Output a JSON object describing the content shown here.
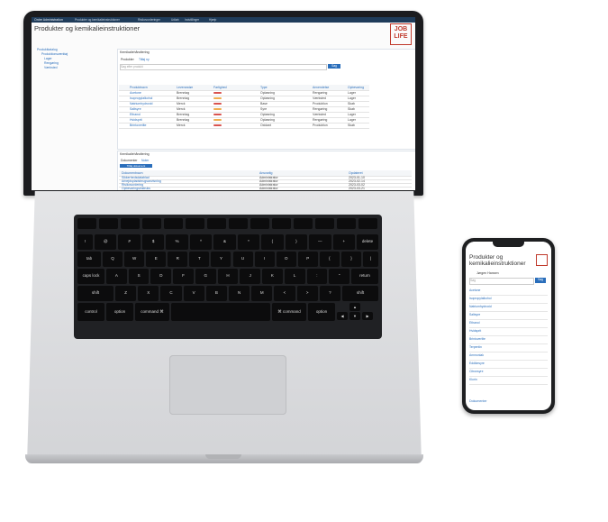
{
  "laptop": {
    "screen": {
      "topbar_title": "Ordre Administration",
      "topbar_nav": [
        "Produkter og kemikalieinstruktioner",
        "Risikovurderinger",
        "Udløb",
        "Indstillinger",
        "Hjælp"
      ],
      "page_title": "Produkter og kemikalieinstruktioner",
      "logo": {
        "line1": "JOB",
        "line2": "LIFE"
      },
      "tree": [
        "Produktkatalog",
        "Produktionsværktøj",
        "Lager",
        "Rengøring",
        "Værksted"
      ],
      "section_title": "Kemikaliehåndtering",
      "tabs": [
        "Produkter",
        "Tilføj ny"
      ],
      "search_placeholder": "Søg efter produkt",
      "search_button": "Søg",
      "table_headers": [
        "Produktnavn",
        "Leverandør",
        "Farlighed",
        "",
        "Type",
        "Anvendelse",
        "Opbevaring"
      ],
      "table_rows": [
        {
          "name": "Acetone",
          "supplier": "Brenntag",
          "type": "Opløsning",
          "use": "Rengøring",
          "storage": "Lager"
        },
        {
          "name": "Isopropylalkohol",
          "supplier": "Brenntag",
          "type": "Opløsning",
          "use": "Værksted",
          "storage": "Lager"
        },
        {
          "name": "Natriumhydroxid",
          "supplier": "Merck",
          "type": "Base",
          "use": "Produktion",
          "storage": "Skab"
        },
        {
          "name": "Saltsyre",
          "supplier": "Merck",
          "type": "Syre",
          "use": "Rengøring",
          "storage": "Skab"
        },
        {
          "name": "Ethanol",
          "supplier": "Brenntag",
          "type": "Opløsning",
          "use": "Værksted",
          "storage": "Lager"
        },
        {
          "name": "Hvidsprit",
          "supplier": "Brenntag",
          "type": "Opløsning",
          "use": "Rengøring",
          "storage": "Lager"
        },
        {
          "name": "Brintoverilte",
          "supplier": "Merck",
          "type": "Oxidant",
          "use": "Produktion",
          "storage": "Skab"
        }
      ],
      "lower_section_title": "Kemikaliehåndtering",
      "lower_tabs": [
        "Dokumenter",
        "Noter"
      ],
      "lower_button": "Tilføj dokument",
      "lower_headers": [
        "Dokumentnavn",
        "Ansvarlig",
        "Opdateret"
      ],
      "lower_rows": [
        {
          "doc": "Sikkerhedsdatablad",
          "who": "Administrator",
          "date": "2023-01-10"
        },
        {
          "doc": "Arbejdspladsbrugsanvisning",
          "who": "Administrator",
          "date": "2023-02-14"
        },
        {
          "doc": "Risikovurdering",
          "who": "Administrator",
          "date": "2023-03-02"
        },
        {
          "doc": "Opbevaringsinstruks",
          "who": "Administrator",
          "date": "2023-03-21"
        }
      ]
    },
    "keyboard": {
      "row_numbers": [
        "!",
        "@",
        "#",
        "$",
        "%",
        "^",
        "&",
        "*",
        "(",
        ")",
        "—",
        "+",
        "delete"
      ],
      "row_q": [
        "tab",
        "Q",
        "W",
        "E",
        "R",
        "T",
        "Y",
        "U",
        "I",
        "O",
        "P",
        "{",
        "}",
        "|"
      ],
      "row_a": [
        "caps lock",
        "A",
        "S",
        "D",
        "F",
        "G",
        "H",
        "J",
        "K",
        "L",
        ":",
        "\"",
        "return"
      ],
      "row_z": [
        "shift",
        "Z",
        "X",
        "C",
        "V",
        "B",
        "N",
        "M",
        "<",
        ">",
        "?",
        "shift"
      ],
      "row_bottom": [
        "control",
        "option",
        "command ⌘",
        "",
        "⌘ command",
        "option"
      ]
    }
  },
  "phone": {
    "title": "Produkter og kemikalieinstruktioner",
    "user": "Jørgen Hansen",
    "search_placeholder": "Søg",
    "search_button": "Søg",
    "items": [
      "Acetone",
      "Isopropylalkohol",
      "Natriumhydroxid",
      "Saltsyre",
      "Ethanol",
      "Hvidsprit",
      "Brintoverilte",
      "Terpentin",
      "Ammoniak",
      "Eddikesyre",
      "Citronsyre",
      "Klorin"
    ],
    "footer": "Dokumenter",
    "colors": {
      "accent": "#2a6ebb",
      "logo": "#c0392b"
    }
  },
  "colors": {
    "topbar": "#1f3c5a",
    "link": "#2a6ebb",
    "danger": "#d9534f",
    "warn": "#f0ad4e"
  }
}
